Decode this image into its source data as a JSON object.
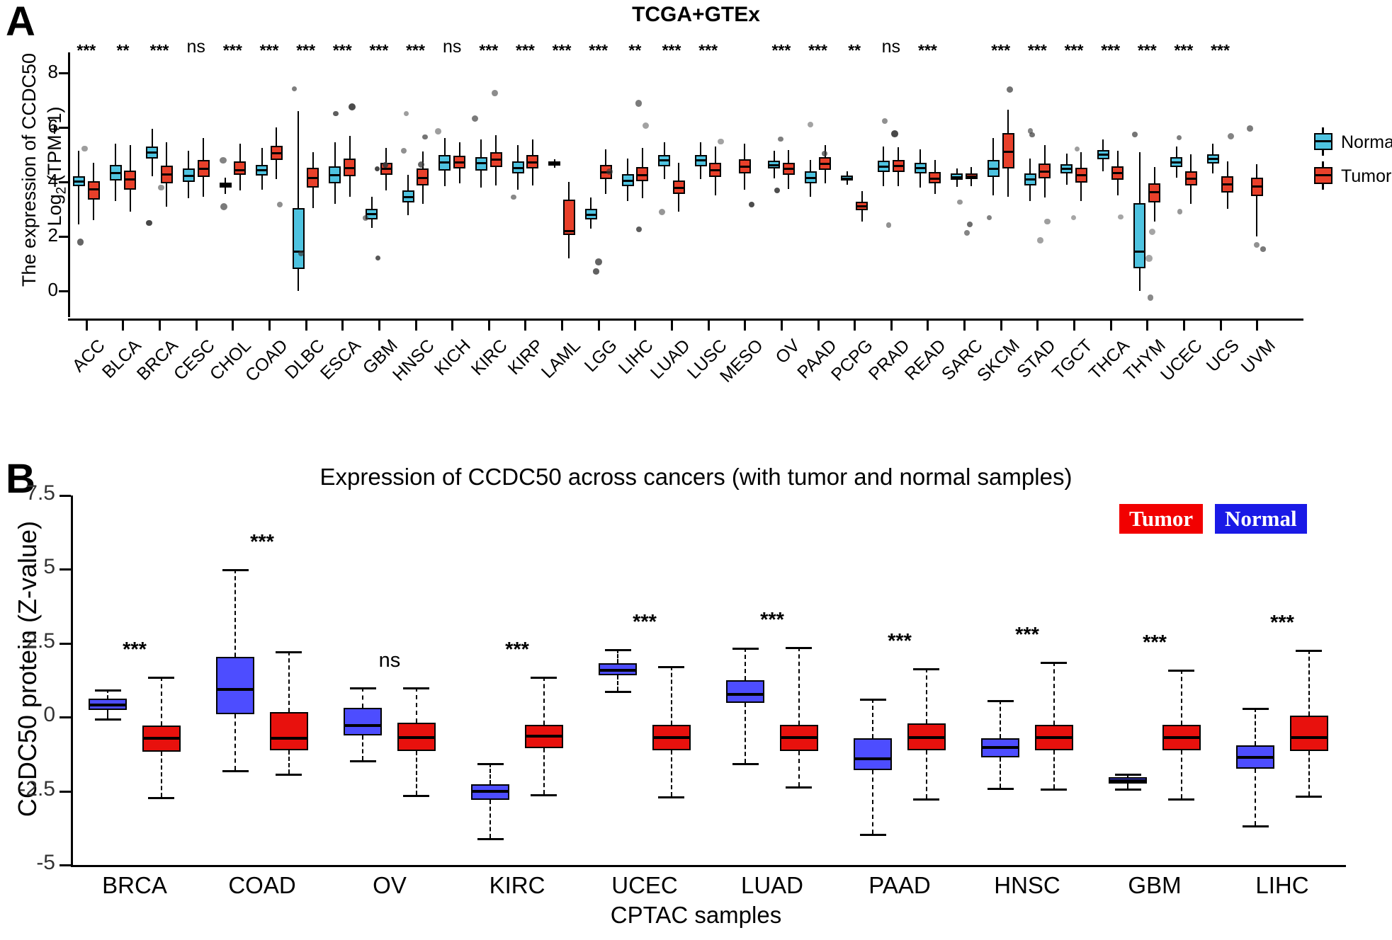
{
  "figure": {
    "panelA_letter": "A",
    "panelB_letter": "B",
    "panelA_title": "TCGA+GTEx",
    "panelB_title": "Expression of CCDC50 across cancers (with tumor and normal samples)"
  },
  "panelA": {
    "ylabel_line1": "The expression of CCDC50",
    "ylabel_line2": "Log",
    "ylabel_sub": "2",
    "ylabel_line2b": " (TPM+1)",
    "yticks": [
      "0",
      "2",
      "4",
      "6",
      "8"
    ],
    "legend": [
      {
        "label": "Normal",
        "color": "#4ec3e0"
      },
      {
        "label": "Tumor",
        "color": "#e8402a"
      }
    ]
  },
  "panelB": {
    "ylabel": "CCDC50 protein (Z-value)",
    "xlabel": "CPTAC samples",
    "yticks": [
      "7.5",
      "5",
      "2.5",
      "0",
      "-2.5",
      "-5"
    ],
    "legend": [
      {
        "label": "Tumor",
        "color": "#f20000"
      },
      {
        "label": "Normal",
        "color": "#1a1ae6"
      }
    ]
  },
  "chart_data": [
    {
      "type": "box",
      "id": "panelA",
      "title": "TCGA+GTEx",
      "xlabel": "",
      "ylabel": "The expression of CCDC50 Log2 (TPM+1)",
      "ylim": [
        -0.5,
        8.6
      ],
      "yticks": [
        0,
        2,
        4,
        6,
        8
      ],
      "legend_position": "right",
      "grid": false,
      "categories": [
        "ACC",
        "BLCA",
        "BRCA",
        "CESC",
        "CHOL",
        "COAD",
        "DLBC",
        "ESCA",
        "GBM",
        "HNSC",
        "KICH",
        "KIRC",
        "KIRP",
        "LAML",
        "LGG",
        "LIHC",
        "LUAD",
        "LUSC",
        "MESO",
        "OV",
        "PAAD",
        "PCPG",
        "PRAD",
        "READ",
        "SARC",
        "SKCM",
        "STAD",
        "TGCT",
        "THCA",
        "THYM",
        "UCEC",
        "UCS",
        "UVM"
      ],
      "significance": [
        "***",
        "**",
        "***",
        "ns",
        "***",
        "***",
        "***",
        "***",
        "***",
        "***",
        "ns",
        "***",
        "***",
        "***",
        "***",
        "**",
        "***",
        "***",
        "",
        "***",
        "***",
        "**",
        "ns",
        "***",
        "",
        "***",
        "***",
        "***",
        "***",
        "***",
        "***",
        "***",
        ""
      ],
      "series": [
        {
          "name": "Normal",
          "color": "#4ec3e0",
          "boxes": [
            {
              "cat": "ACC",
              "q1": 3.85,
              "median": 4.02,
              "q3": 4.2,
              "low": 2.45,
              "high": 5.15
            },
            {
              "cat": "BLCA",
              "q1": 4.05,
              "median": 4.33,
              "q3": 4.62,
              "low": 3.3,
              "high": 5.4
            },
            {
              "cat": "BRCA",
              "q1": 4.85,
              "median": 5.08,
              "q3": 5.3,
              "low": 4.2,
              "high": 5.95
            },
            {
              "cat": "CESC",
              "q1": 4.0,
              "median": 4.22,
              "q3": 4.5,
              "low": 3.4,
              "high": 5.15
            },
            {
              "cat": "CHOL",
              "q1": 3.78,
              "median": 3.88,
              "q3": 3.98,
              "low": 3.55,
              "high": 4.15
            },
            {
              "cat": "COAD",
              "q1": 4.22,
              "median": 4.42,
              "q3": 4.62,
              "low": 3.7,
              "high": 5.25
            },
            {
              "cat": "DLBC",
              "q1": 0.8,
              "median": 1.45,
              "q3": 3.05,
              "low": 0.0,
              "high": 6.6
            },
            {
              "cat": "ESCA",
              "q1": 3.95,
              "median": 4.25,
              "q3": 4.58,
              "low": 3.2,
              "high": 5.45
            },
            {
              "cat": "GBM",
              "q1": 2.62,
              "median": 2.82,
              "q3": 3.02,
              "low": 2.3,
              "high": 3.45
            },
            {
              "cat": "HNSC",
              "q1": 3.25,
              "median": 3.45,
              "q3": 3.68,
              "low": 2.78,
              "high": 4.25
            },
            {
              "cat": "KICH",
              "q1": 4.42,
              "median": 4.72,
              "q3": 4.98,
              "low": 3.85,
              "high": 5.6
            },
            {
              "cat": "KIRC",
              "q1": 4.42,
              "median": 4.68,
              "q3": 4.92,
              "low": 3.8,
              "high": 5.55
            },
            {
              "cat": "KIRP",
              "q1": 4.3,
              "median": 4.5,
              "q3": 4.75,
              "low": 3.72,
              "high": 5.35
            },
            {
              "cat": "LAML",
              "q1": 4.6,
              "median": 4.66,
              "q3": 4.74,
              "low": 4.52,
              "high": 4.82
            },
            {
              "cat": "LGG",
              "q1": 2.62,
              "median": 2.8,
              "q3": 3.0,
              "low": 2.28,
              "high": 3.42
            },
            {
              "cat": "LIHC",
              "q1": 3.85,
              "median": 4.05,
              "q3": 4.28,
              "low": 3.3,
              "high": 4.85
            },
            {
              "cat": "LUAD",
              "q1": 4.58,
              "median": 4.78,
              "q3": 4.98,
              "low": 4.1,
              "high": 5.45
            },
            {
              "cat": "LUSC",
              "q1": 4.58,
              "median": 4.78,
              "q3": 4.98,
              "low": 4.1,
              "high": 5.45
            },
            {
              "cat": "OV",
              "q1": 4.48,
              "median": 4.62,
              "q3": 4.78,
              "low": 4.12,
              "high": 5.15
            },
            {
              "cat": "PAAD",
              "q1": 3.95,
              "median": 4.15,
              "q3": 4.38,
              "low": 3.45,
              "high": 4.8
            },
            {
              "cat": "PCPG",
              "q1": 4.05,
              "median": 4.12,
              "q3": 4.22,
              "low": 3.9,
              "high": 4.38
            },
            {
              "cat": "PRAD",
              "q1": 4.35,
              "median": 4.55,
              "q3": 4.78,
              "low": 3.85,
              "high": 5.3
            },
            {
              "cat": "READ",
              "q1": 4.3,
              "median": 4.5,
              "q3": 4.7,
              "low": 3.8,
              "high": 5.2
            },
            {
              "cat": "SARC",
              "q1": 4.08,
              "median": 4.18,
              "q3": 4.3,
              "low": 3.82,
              "high": 4.5
            },
            {
              "cat": "SKCM",
              "q1": 4.18,
              "median": 4.48,
              "q3": 4.8,
              "low": 3.5,
              "high": 5.6
            },
            {
              "cat": "STAD",
              "q1": 3.88,
              "median": 4.08,
              "q3": 4.32,
              "low": 3.3,
              "high": 4.85
            },
            {
              "cat": "TGCT",
              "q1": 4.3,
              "median": 4.48,
              "q3": 4.65,
              "low": 3.9,
              "high": 5.05
            },
            {
              "cat": "THCA",
              "q1": 4.82,
              "median": 5.0,
              "q3": 5.18,
              "low": 4.4,
              "high": 5.55
            },
            {
              "cat": "THYM",
              "q1": 0.82,
              "median": 1.45,
              "q3": 3.22,
              "low": 0.0,
              "high": 5.1
            },
            {
              "cat": "UCEC",
              "q1": 4.55,
              "median": 4.72,
              "q3": 4.9,
              "low": 4.15,
              "high": 5.3
            },
            {
              "cat": "UCS",
              "q1": 4.68,
              "median": 4.85,
              "q3": 5.0,
              "low": 4.3,
              "high": 5.4
            }
          ]
        },
        {
          "name": "Tumor",
          "color": "#e8402a",
          "boxes": [
            {
              "cat": "ACC",
              "q1": 3.35,
              "median": 3.72,
              "q3": 4.02,
              "low": 2.6,
              "high": 4.7
            },
            {
              "cat": "BLCA",
              "q1": 3.72,
              "median": 4.08,
              "q3": 4.42,
              "low": 2.9,
              "high": 5.35
            },
            {
              "cat": "BRCA",
              "q1": 3.95,
              "median": 4.28,
              "q3": 4.6,
              "low": 3.1,
              "high": 5.45
            },
            {
              "cat": "CESC",
              "q1": 4.18,
              "median": 4.48,
              "q3": 4.8,
              "low": 3.45,
              "high": 5.6
            },
            {
              "cat": "CHOL",
              "q1": 4.25,
              "median": 4.42,
              "q3": 4.75,
              "low": 3.7,
              "high": 5.4
            },
            {
              "cat": "COAD",
              "q1": 4.8,
              "median": 5.05,
              "q3": 5.32,
              "low": 4.1,
              "high": 6.0
            },
            {
              "cat": "DLBC",
              "q1": 3.78,
              "median": 4.15,
              "q3": 4.52,
              "low": 3.05,
              "high": 5.1
            },
            {
              "cat": "ESCA",
              "q1": 4.2,
              "median": 4.5,
              "q3": 4.85,
              "low": 3.45,
              "high": 5.7
            },
            {
              "cat": "GBM",
              "q1": 4.25,
              "median": 4.48,
              "q3": 4.7,
              "low": 3.7,
              "high": 5.25
            },
            {
              "cat": "HNSC",
              "q1": 3.88,
              "median": 4.15,
              "q3": 4.48,
              "low": 3.2,
              "high": 5.12
            },
            {
              "cat": "KICH",
              "q1": 4.48,
              "median": 4.72,
              "q3": 4.95,
              "low": 3.95,
              "high": 5.45
            },
            {
              "cat": "KIRC",
              "q1": 4.55,
              "median": 4.82,
              "q3": 5.1,
              "low": 3.88,
              "high": 5.72
            },
            {
              "cat": "KIRP",
              "q1": 4.48,
              "median": 4.72,
              "q3": 4.98,
              "low": 3.88,
              "high": 5.55
            },
            {
              "cat": "LAML",
              "q1": 2.05,
              "median": 2.18,
              "q3": 3.35,
              "low": 1.2,
              "high": 4.0
            },
            {
              "cat": "LGG",
              "q1": 4.1,
              "median": 4.35,
              "q3": 4.62,
              "low": 3.55,
              "high": 5.2
            },
            {
              "cat": "LIHC",
              "q1": 4.02,
              "median": 4.25,
              "q3": 4.55,
              "low": 3.4,
              "high": 5.25
            },
            {
              "cat": "LUAD",
              "q1": 3.55,
              "median": 3.78,
              "q3": 4.05,
              "low": 2.9,
              "high": 4.7
            },
            {
              "cat": "LUSC",
              "q1": 4.18,
              "median": 4.42,
              "q3": 4.7,
              "low": 3.5,
              "high": 5.3
            },
            {
              "cat": "MESO",
              "q1": 4.3,
              "median": 4.55,
              "q3": 4.82,
              "low": 3.7,
              "high": 5.4
            },
            {
              "cat": "OV",
              "q1": 4.25,
              "median": 4.48,
              "q3": 4.7,
              "low": 3.75,
              "high": 5.18
            },
            {
              "cat": "PAAD",
              "q1": 4.45,
              "median": 4.65,
              "q3": 4.9,
              "low": 3.95,
              "high": 5.35
            },
            {
              "cat": "PCPG",
              "q1": 2.95,
              "median": 3.1,
              "q3": 3.28,
              "low": 2.55,
              "high": 3.65
            },
            {
              "cat": "PRAD",
              "q1": 4.35,
              "median": 4.58,
              "q3": 4.8,
              "low": 3.85,
              "high": 5.28
            },
            {
              "cat": "READ",
              "q1": 3.95,
              "median": 4.12,
              "q3": 4.35,
              "low": 3.55,
              "high": 4.8
            },
            {
              "cat": "SARC",
              "q1": 4.1,
              "median": 4.2,
              "q3": 4.32,
              "low": 3.85,
              "high": 4.55
            },
            {
              "cat": "SKCM",
              "q1": 4.5,
              "median": 5.1,
              "q3": 5.78,
              "low": 3.45,
              "high": 6.65
            },
            {
              "cat": "STAD",
              "q1": 4.12,
              "median": 4.38,
              "q3": 4.68,
              "low": 3.42,
              "high": 5.35
            },
            {
              "cat": "TGCT",
              "q1": 3.98,
              "median": 4.25,
              "q3": 4.52,
              "low": 3.3,
              "high": 5.1
            },
            {
              "cat": "THCA",
              "q1": 4.08,
              "median": 4.32,
              "q3": 4.58,
              "low": 3.5,
              "high": 5.15
            },
            {
              "cat": "THYM",
              "q1": 3.25,
              "median": 3.62,
              "q3": 3.95,
              "low": 2.55,
              "high": 4.55
            },
            {
              "cat": "UCEC",
              "q1": 3.88,
              "median": 4.12,
              "q3": 4.4,
              "low": 3.2,
              "high": 5.0
            },
            {
              "cat": "UCS",
              "q1": 3.62,
              "median": 3.92,
              "q3": 4.2,
              "low": 3.0,
              "high": 4.75
            },
            {
              "cat": "UVM",
              "q1": 3.48,
              "median": 3.82,
              "q3": 4.15,
              "low": 2.0,
              "high": 4.65
            }
          ]
        }
      ]
    },
    {
      "type": "box",
      "id": "panelB",
      "title": "Expression of CCDC50 across cancers (with tumor and normal samples)",
      "xlabel": "CPTAC samples",
      "ylabel": "CCDC50 protein (Z-value)",
      "ylim": [
        -5,
        7.5
      ],
      "yticks": [
        -5,
        -2.5,
        0,
        2.5,
        5,
        7.5
      ],
      "legend_position": "top-right",
      "grid": false,
      "categories": [
        "BRCA",
        "COAD",
        "OV",
        "KIRC",
        "UCEC",
        "LUAD",
        "PAAD",
        "HNSC",
        "GBM",
        "LIHC"
      ],
      "significance": [
        "***",
        "***",
        "ns",
        "***",
        "***",
        "***",
        "***",
        "***",
        "***",
        "***"
      ],
      "series": [
        {
          "name": "Normal",
          "color": "#4d4dff",
          "boxes": [
            {
              "cat": "BRCA",
              "q1": 0.25,
              "median": 0.42,
              "q3": 0.62,
              "low": -0.05,
              "high": 0.95
            },
            {
              "cat": "COAD",
              "q1": 0.1,
              "median": 0.95,
              "q3": 2.05,
              "low": -1.8,
              "high": 5.0
            },
            {
              "cat": "OV",
              "q1": -0.62,
              "median": -0.28,
              "q3": 0.32,
              "low": -1.45,
              "high": 1.0
            },
            {
              "cat": "KIRC",
              "q1": -2.8,
              "median": -2.52,
              "q3": -2.28,
              "low": -4.1,
              "high": -1.55
            },
            {
              "cat": "UCEC",
              "q1": 1.42,
              "median": 1.58,
              "q3": 1.82,
              "low": 0.88,
              "high": 2.3
            },
            {
              "cat": "LUAD",
              "q1": 0.48,
              "median": 0.78,
              "q3": 1.25,
              "low": -1.55,
              "high": 2.35
            },
            {
              "cat": "PAAD",
              "q1": -1.78,
              "median": -1.42,
              "q3": -0.72,
              "low": -3.95,
              "high": 0.62
            },
            {
              "cat": "HNSC",
              "q1": -1.35,
              "median": -1.02,
              "q3": -0.72,
              "low": -2.4,
              "high": 0.58
            },
            {
              "cat": "GBM",
              "q1": -2.25,
              "median": -2.15,
              "q3": -2.02,
              "low": -2.42,
              "high": -1.9
            },
            {
              "cat": "LIHC",
              "q1": -1.75,
              "median": -1.35,
              "q3": -0.95,
              "low": -3.65,
              "high": 0.32
            }
          ]
        },
        {
          "name": "Tumor",
          "color": "#e8110d",
          "boxes": [
            {
              "cat": "BRCA",
              "q1": -1.18,
              "median": -0.72,
              "q3": -0.28,
              "low": -2.7,
              "high": 1.38
            },
            {
              "cat": "COAD",
              "q1": -1.12,
              "median": -0.72,
              "q3": 0.18,
              "low": -1.92,
              "high": 2.22
            },
            {
              "cat": "OV",
              "q1": -1.15,
              "median": -0.68,
              "q3": -0.18,
              "low": -2.62,
              "high": 1.02
            },
            {
              "cat": "KIRC",
              "q1": -1.05,
              "median": -0.65,
              "q3": -0.25,
              "low": -2.6,
              "high": 1.38
            },
            {
              "cat": "UCEC",
              "q1": -1.12,
              "median": -0.68,
              "q3": -0.25,
              "low": -2.68,
              "high": 1.72
            },
            {
              "cat": "LUAD",
              "q1": -1.15,
              "median": -0.68,
              "q3": -0.25,
              "low": -2.35,
              "high": 2.38
            },
            {
              "cat": "PAAD",
              "q1": -1.12,
              "median": -0.7,
              "q3": -0.22,
              "low": -2.75,
              "high": 1.65
            },
            {
              "cat": "HNSC",
              "q1": -1.12,
              "median": -0.68,
              "q3": -0.25,
              "low": -2.42,
              "high": 1.88
            },
            {
              "cat": "GBM",
              "q1": -1.12,
              "median": -0.7,
              "q3": -0.25,
              "low": -2.75,
              "high": 1.62
            },
            {
              "cat": "LIHC",
              "q1": -1.15,
              "median": -0.7,
              "q3": 0.05,
              "low": -2.65,
              "high": 2.28
            }
          ]
        }
      ]
    }
  ]
}
